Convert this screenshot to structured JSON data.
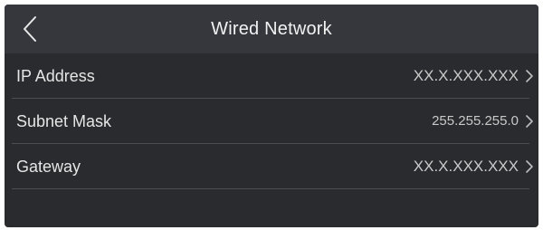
{
  "header": {
    "title": "Wired Network",
    "back_icon": "chevron-left-icon"
  },
  "rows": [
    {
      "label": "IP Address",
      "value": "XX.X.XXX.XXX",
      "icon": "chevron-right-icon"
    },
    {
      "label": "Subnet Mask",
      "value": "255.255.255.0",
      "icon": "chevron-right-icon"
    },
    {
      "label": "Gateway",
      "value": "XX.X.XXX.XXX",
      "icon": "chevron-right-icon"
    }
  ],
  "colors": {
    "background": "#2a2b2f",
    "header": "#35373d",
    "divider": "#4b4d53",
    "text": "#e6e6e6"
  }
}
